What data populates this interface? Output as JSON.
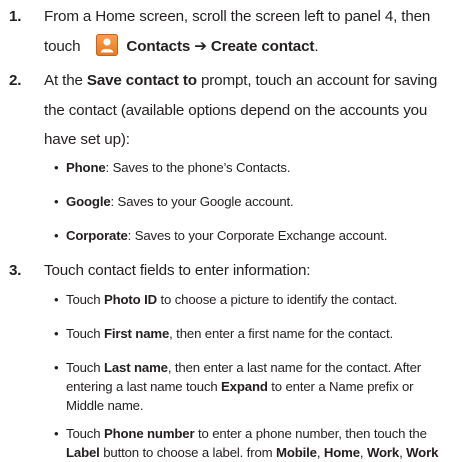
{
  "steps": [
    {
      "number": "1.",
      "line1": "From a Home screen, scroll the screen left to panel 4, then",
      "touch": "touch",
      "icon": "contacts-app-icon",
      "path": "Contacts ➔ Create contact",
      "end": "."
    },
    {
      "number": "2.",
      "line1_pre": "At the ",
      "line1_bold": "Save contact to",
      "line1_post": " prompt, touch an account for saving",
      "line2": "the contact (available options depend on the accounts you",
      "line3": "have set up):",
      "bullets": [
        {
          "term": "Phone",
          "text": ": Saves to the phone’s Contacts."
        },
        {
          "term": "Google",
          "text": ": Saves to your Google account."
        },
        {
          "term": "Corporate",
          "text": ": Saves to your Corporate Exchange account."
        }
      ]
    },
    {
      "number": "3.",
      "line1": "Touch contact fields to enter information:",
      "bullets": [
        {
          "pre": "Touch ",
          "term": "Photo ID",
          "text": " to choose a picture to identify the contact."
        },
        {
          "pre": "Touch ",
          "term": "First name",
          "text": ", then enter a first name for the contact."
        },
        {
          "pre": "Touch ",
          "term": "Last name",
          "text": ", then enter a last name for the contact. After",
          "line2_pre": "entering a last name touch ",
          "line2_bold": "Expand",
          "line2_post": " to enter a Name prefix or",
          "line3": "Middle name."
        },
        {
          "pre": "Touch ",
          "term": "Phone number",
          "text": " to enter a phone number, then touch the",
          "line2_bold1": "Label",
          "line2_mid": " button to choose a label. from ",
          "line2_bold2": "Mobile",
          "line2_sep1": ", ",
          "line2_bold3": "Home",
          "line2_sep2": ", ",
          "line2_bold4": "Work",
          "line2_sep3": ", ",
          "line2_bold5": "Work"
        }
      ]
    }
  ]
}
